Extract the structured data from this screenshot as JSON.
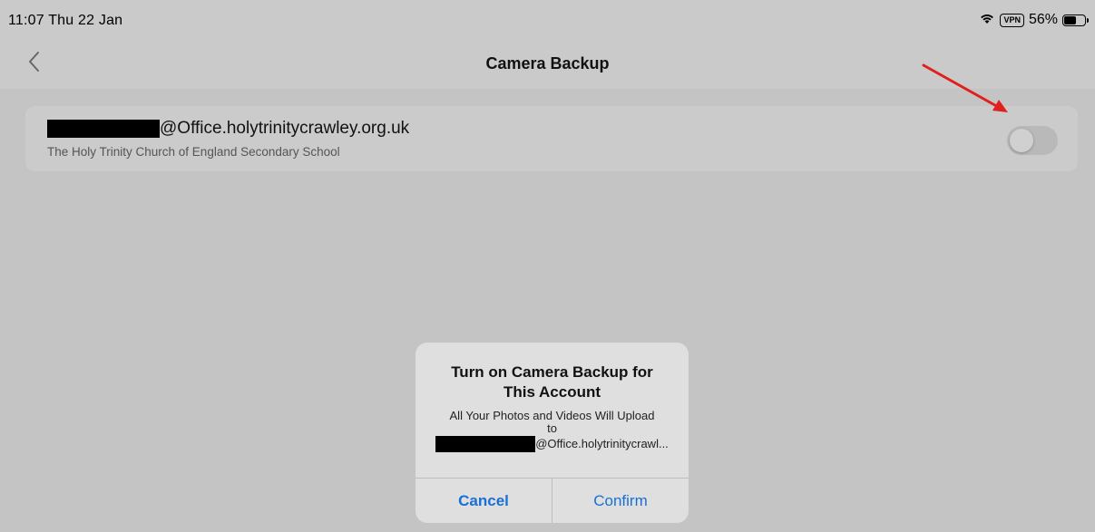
{
  "status_bar": {
    "time_date": "11:07  Thu 22 Jan",
    "vpn": "VPN",
    "battery": "56%"
  },
  "nav": {
    "title": "Camera Backup"
  },
  "account": {
    "email_domain": "@Office.holytrinitycrawley.org.uk",
    "organization": "The Holy Trinity Church of England Secondary School",
    "backup_enabled": false
  },
  "alert": {
    "title": "Turn on Camera Backup for This Account",
    "message_line1": "All Your Photos and Videos Will Upload",
    "message_line2": "to",
    "message_email": "@Office.holytrinitycrawl...",
    "cancel_label": "Cancel",
    "confirm_label": "Confirm"
  },
  "colors": {
    "accent": "#1870d6",
    "annotation_arrow": "#e0201c"
  }
}
